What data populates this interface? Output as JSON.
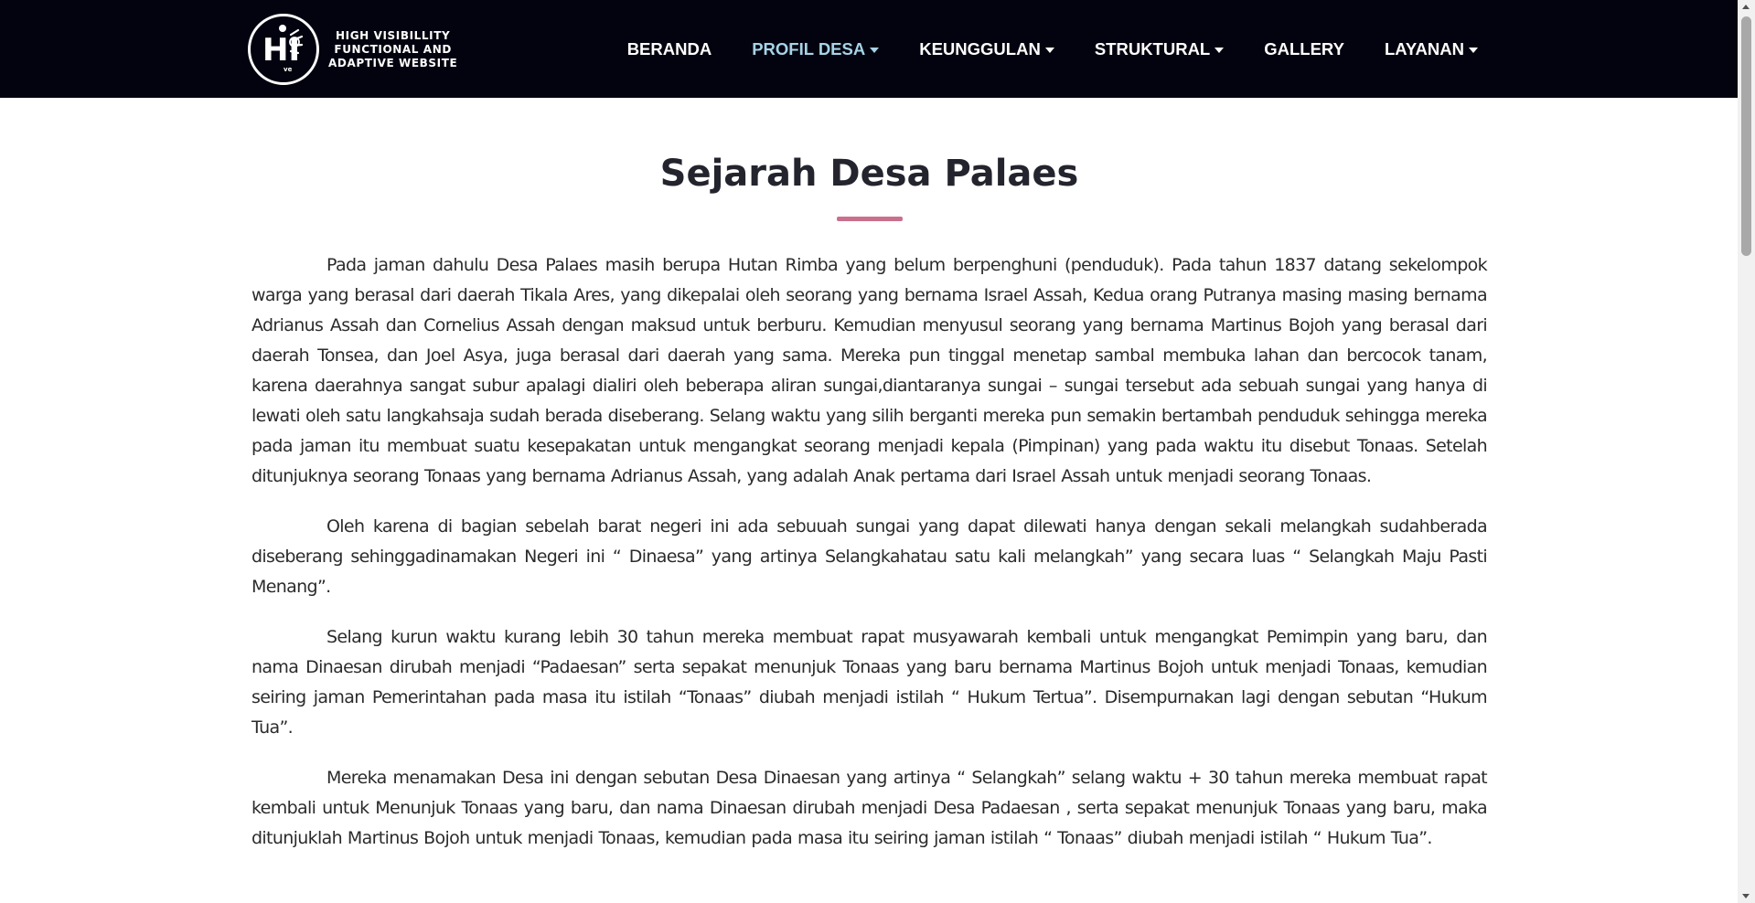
{
  "brand": {
    "logo_letters": "HI",
    "logo_sub": "ve",
    "line1": "HIGH VISIBILLITY",
    "line2": "FUNCTIONAL AND",
    "line3": "ADAPTIVE WEBSITE"
  },
  "nav": {
    "items": [
      {
        "label": "BERANDA",
        "dropdown": false
      },
      {
        "label": "PROFIL DESA",
        "dropdown": true,
        "active": true
      },
      {
        "label": "KEUNGGULAN",
        "dropdown": true
      },
      {
        "label": "STRUKTURAL",
        "dropdown": true
      },
      {
        "label": "GALLERY",
        "dropdown": false
      },
      {
        "label": "LAYANAN",
        "dropdown": true
      }
    ]
  },
  "colors": {
    "navbar_bg": "#03030f",
    "active_nav": "#a6d3e6",
    "title_rule": "#c9708c"
  },
  "page": {
    "title": "Sejarah Desa Palaes",
    "paragraphs": [
      "Pada jaman dahulu Desa Palaes masih berupa Hutan Rimba yang belum berpenghuni (penduduk). Pada tahun 1837 datang sekelompok warga yang berasal dari daerah Tikala Ares, yang dikepalai oleh seorang yang bernama Israel Assah, Kedua orang Putranya masing masing bernama Adrianus Assah dan Cornelius Assah dengan maksud untuk berburu. Kemudian menyusul seorang yang bernama Martinus Bojoh yang berasal dari daerah Tonsea, dan Joel Asya, juga berasal dari daerah yang sama. Mereka pun tinggal menetap sambal membuka lahan dan bercocok tanam, karena daerahnya sangat subur apalagi dialiri oleh beberapa aliran sungai,diantaranya sungai – sungai tersebut ada sebuah sungai yang hanya di lewati oleh satu langkahsaja sudah berada diseberang. Selang waktu yang silih berganti mereka pun semakin bertambah penduduk sehingga mereka pada jaman itu membuat suatu kesepakatan untuk mengangkat seorang menjadi kepala (Pimpinan) yang pada waktu itu disebut Tonaas. Setelah ditunjuknya seorang Tonaas yang bernama Adrianus Assah, yang adalah Anak pertama dari Israel Assah untuk menjadi seorang Tonaas.",
      "Oleh karena di bagian sebelah barat negeri ini ada sebuuah sungai yang dapat dilewati hanya dengan sekali melangkah sudahberada diseberang sehinggadinamakan Negeri ini “ Dinaesa” yang artinya Selangkahatau satu kali melangkah” yang secara luas “ Selangkah Maju Pasti Menang”.",
      "Selang kurun waktu kurang lebih 30 tahun mereka membuat rapat musyawarah kembali untuk mengangkat Pemimpin yang baru, dan nama Dinaesan dirubah menjadi “Padaesan” serta sepakat menunjuk Tonaas yang baru bernama Martinus Bojoh untuk menjadi Tonaas, kemudian seiring jaman Pemerintahan pada masa itu istilah “Tonaas” diubah menjadi istilah “ Hukum Tertua”. Disempurnakan lagi dengan sebutan “Hukum Tua”.",
      "Mereka menamakan Desa ini dengan sebutan Desa Dinaesan yang artinya “ Selangkah” selang waktu + 30 tahun mereka membuat rapat kembali untuk Menunjuk Tonaas yang baru, dan nama Dinaesan dirubah menjadi Desa Padaesan , serta sepakat menunjuk Tonaas yang baru, maka ditunjuklah Martinus Bojoh untuk menjadi Tonaas, kemudian pada masa itu seiring jaman istilah “ Tonaas” diubah menjadi istilah “ Hukum Tua”."
    ]
  }
}
